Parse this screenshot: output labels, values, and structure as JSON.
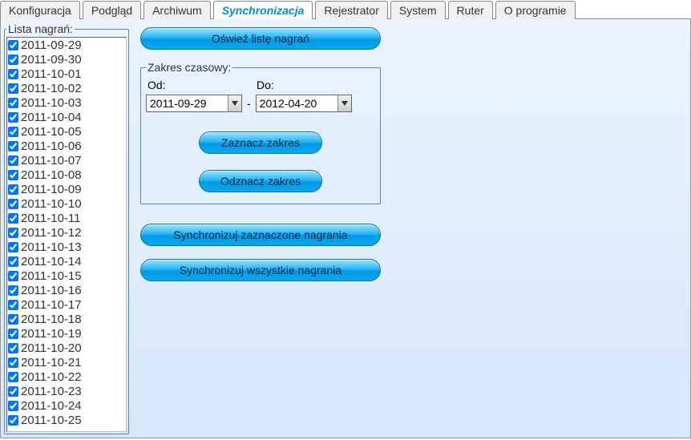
{
  "tabs": [
    {
      "label": "Konfiguracja",
      "active": false
    },
    {
      "label": "Podgląd",
      "active": false
    },
    {
      "label": "Archiwum",
      "active": false
    },
    {
      "label": "Synchronizacja",
      "active": true
    },
    {
      "label": "Rejestrator",
      "active": false
    },
    {
      "label": "System",
      "active": false
    },
    {
      "label": "Ruter",
      "active": false
    },
    {
      "label": "O programie",
      "active": false
    }
  ],
  "listTitle": "Lista nagrań:",
  "recordings": [
    {
      "date": "2011-09-29",
      "checked": true
    },
    {
      "date": "2011-09-30",
      "checked": true
    },
    {
      "date": "2011-10-01",
      "checked": true
    },
    {
      "date": "2011-10-02",
      "checked": true
    },
    {
      "date": "2011-10-03",
      "checked": true
    },
    {
      "date": "2011-10-04",
      "checked": true
    },
    {
      "date": "2011-10-05",
      "checked": true
    },
    {
      "date": "2011-10-06",
      "checked": true
    },
    {
      "date": "2011-10-07",
      "checked": true
    },
    {
      "date": "2011-10-08",
      "checked": true
    },
    {
      "date": "2011-10-09",
      "checked": true
    },
    {
      "date": "2011-10-10",
      "checked": true
    },
    {
      "date": "2011-10-11",
      "checked": true
    },
    {
      "date": "2011-10-12",
      "checked": true
    },
    {
      "date": "2011-10-13",
      "checked": true
    },
    {
      "date": "2011-10-14",
      "checked": true
    },
    {
      "date": "2011-10-15",
      "checked": true
    },
    {
      "date": "2011-10-16",
      "checked": true
    },
    {
      "date": "2011-10-17",
      "checked": true
    },
    {
      "date": "2011-10-18",
      "checked": true
    },
    {
      "date": "2011-10-19",
      "checked": true
    },
    {
      "date": "2011-10-20",
      "checked": true
    },
    {
      "date": "2011-10-21",
      "checked": true
    },
    {
      "date": "2011-10-22",
      "checked": true
    },
    {
      "date": "2011-10-23",
      "checked": true
    },
    {
      "date": "2011-10-24",
      "checked": true
    },
    {
      "date": "2011-10-25",
      "checked": true
    }
  ],
  "buttons": {
    "refresh": "Oświeź listę nagrań",
    "selectRange": "Zaznacz zakres",
    "deselectRange": "Odznacz zakres",
    "syncSelected": "Synchronizuj zaznaczone nagrania",
    "syncAll": "Synchronizuj wszystkie nagrania"
  },
  "range": {
    "title": "Zakres czasowy:",
    "fromLabel": "Od:",
    "toLabel": "Do:",
    "from": "2011-09-29",
    "to": "2012-04-20",
    "separator": "-"
  }
}
